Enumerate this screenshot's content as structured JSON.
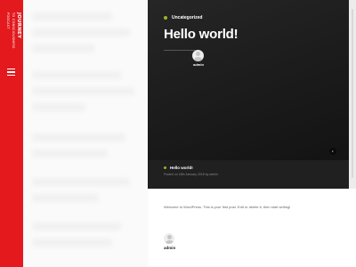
{
  "sidebar": {
    "brand": {
      "line1": "JOURNEY",
      "line2": "TO CONSCIOUSNESS",
      "line3": "PODCAST"
    },
    "menu_icon": "hamburger-icon",
    "color": "#e3191d"
  },
  "hero": {
    "category": "Uncategorized",
    "title": "Hello world!",
    "author": "admin",
    "accent": "#9ab624"
  },
  "meta": {
    "title": "Hello world!",
    "subtitle": "Posted on 18th January 2018 by admin"
  },
  "content": {
    "excerpt": "Welcome to WordPress. This is your first post. Edit or delete it, then start writing!",
    "author": "admin"
  }
}
